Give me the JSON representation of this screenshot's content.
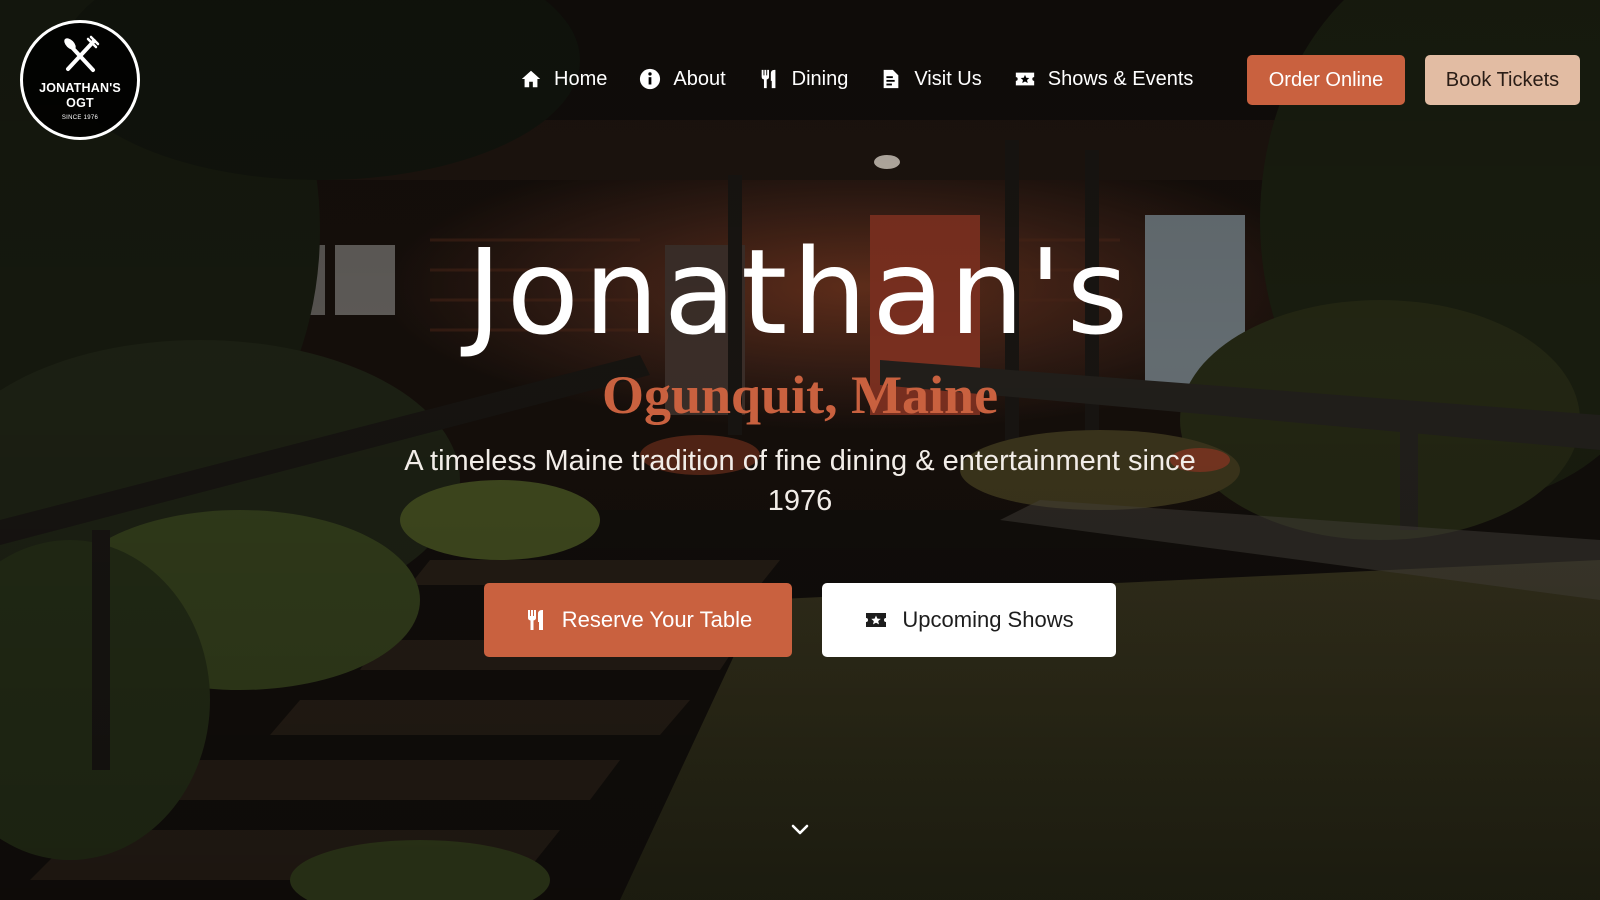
{
  "brand": {
    "logo_name": "JONATHAN'S\nOGT",
    "logo_since": "SINCE 1976"
  },
  "nav": {
    "items": [
      {
        "label": "Home",
        "icon": "home-icon"
      },
      {
        "label": "About",
        "icon": "info-icon"
      },
      {
        "label": "Dining",
        "icon": "utensils-icon"
      },
      {
        "label": "Visit Us",
        "icon": "map-icon"
      },
      {
        "label": "Shows & Events",
        "icon": "ticket-icon"
      }
    ],
    "order_online": "Order Online",
    "book_tickets": "Book Tickets"
  },
  "hero": {
    "title": "Jonathan's",
    "subtitle": "Ogunquit, Maine",
    "tagline": "A timeless Maine tradition of fine dining & entertainment since 1976",
    "reserve_label": "Reserve Your Table",
    "shows_label": "Upcoming Shows"
  },
  "colors": {
    "accent": "#c9613f",
    "accent_light": "#e2bca3",
    "text": "#ffffff"
  },
  "icons": {
    "scroll": "chevron-down-icon"
  }
}
